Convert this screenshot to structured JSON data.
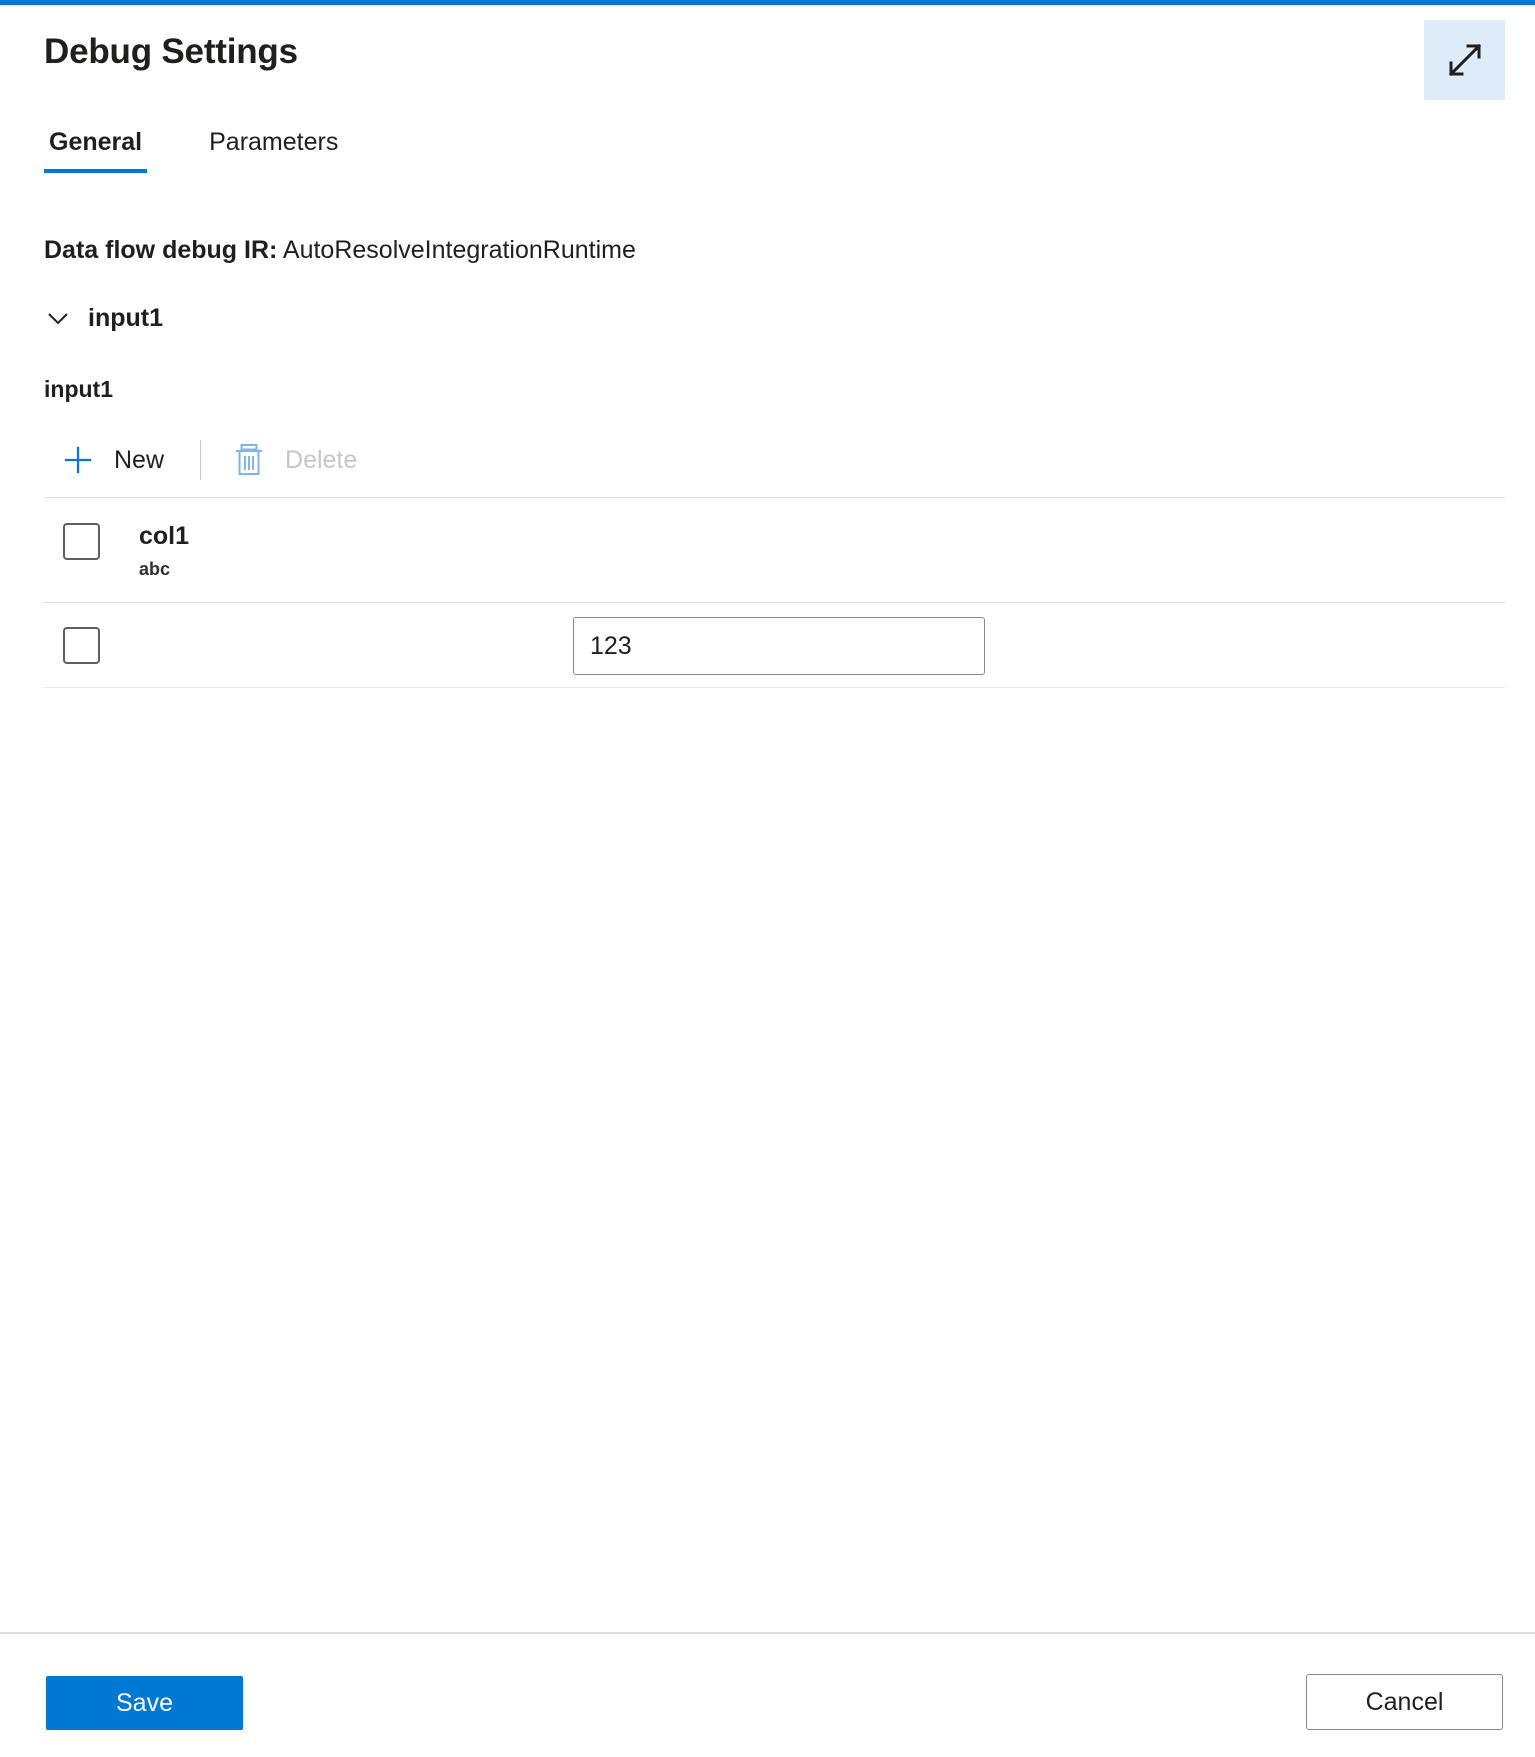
{
  "window": {
    "title": "Debug Settings",
    "accent_color": "#0078d4",
    "expand_icon": "expand-diagonal-arrows-icon"
  },
  "tabs": [
    {
      "label": "General",
      "active": true
    },
    {
      "label": "Parameters",
      "active": false
    }
  ],
  "general": {
    "ir_label": "Data flow debug IR:",
    "ir_value": "AutoResolveIntegrationRuntime",
    "stream_toggle": {
      "label": "input1",
      "chevron_icon": "chevron-down-icon",
      "expanded": true
    },
    "source_name": "input1",
    "command_bar": {
      "new_label": "New",
      "new_icon": "plus-icon",
      "delete_label": "Delete",
      "delete_icon": "trash-icon",
      "delete_disabled": true
    },
    "grid": {
      "header": {
        "select_all_checked": false,
        "column_name": "col1",
        "column_type": "abc"
      },
      "rows": [
        {
          "selected": false,
          "value": "123"
        }
      ]
    }
  },
  "footer": {
    "save_label": "Save",
    "cancel_label": "Cancel"
  }
}
